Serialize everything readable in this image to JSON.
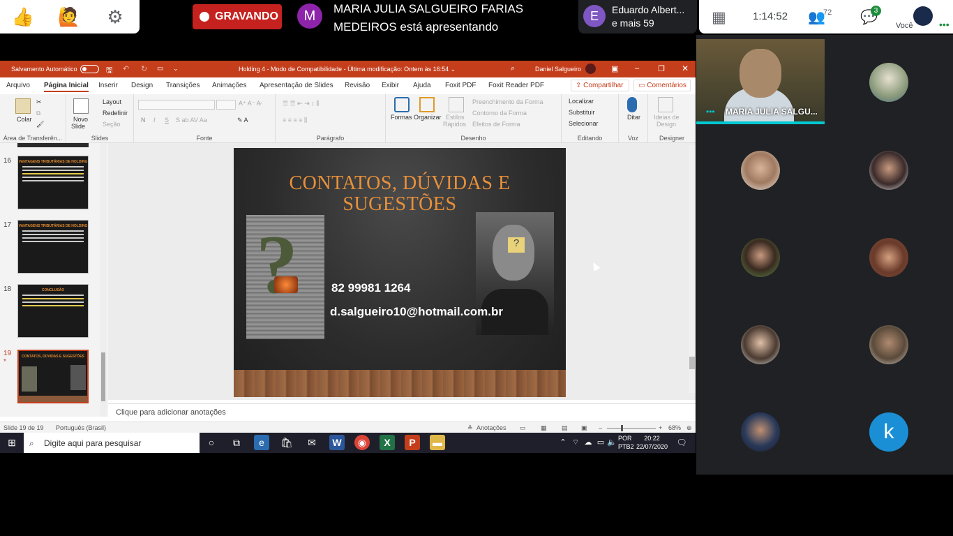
{
  "meet": {
    "recording_label": "GRAVANDO",
    "presenter_initial": "M",
    "presenter_line1": "MARIA JULIA SALGUEIRO FARIAS",
    "presenter_line2": "MEDEIROS está apresentando",
    "others_initial": "E",
    "others_line1": "Eduardo Albert...",
    "others_line2": "e mais 59",
    "timer": "1:14:52",
    "people_count": "72",
    "chat_badge": "3",
    "self_label": "Você",
    "speaker_name": "MARIA JULIA SALGU...",
    "participant_k": "k"
  },
  "ppt": {
    "autosave_label": "Salvamento Automático",
    "doc_title": "Holding 4  -  Modo de Compatibilidade  -  Última modificação: Ontem às 16:54  ⌄",
    "user_name": "Daniel Salgueiro",
    "menu": [
      "Arquivo",
      "Página Inicial",
      "Inserir",
      "Design",
      "Transições",
      "Animações",
      "Apresentação de Slides",
      "Revisão",
      "Exibir",
      "Ajuda",
      "Foxit PDF",
      "Foxit Reader PDF"
    ],
    "share_label": "Compartilhar",
    "comments_label": "Comentários",
    "ribbon": {
      "colar": "Colar",
      "area_transferencia": "Área de Transferên...",
      "novo_slide": "Novo",
      "novo_slide2": "Slide",
      "layout": "Layout",
      "redefinir": "Redefinir",
      "secao": "Seção",
      "slides": "Slides",
      "fonte": "Fonte",
      "paragrafo": "Parágrafo",
      "formas": "Formas",
      "organizar": "Organizar",
      "estilos": "Estilos",
      "estilos2": "Rápidos",
      "preenchimento": "Preenchimento da Forma",
      "contorno": "Contorno da Forma",
      "efeitos": "Efeitos de Forma",
      "desenho": "Desenho",
      "localizar": "Localizar",
      "substituir": "Substituir",
      "selecionar": "Selecionar",
      "editando": "Editando",
      "ditar": "Ditar",
      "voz": "Voz",
      "ideias": "Ideias de",
      "ideias2": "Design",
      "designer": "Designer"
    },
    "thumbnails": [
      {
        "num": "16",
        "title": "VANTAGENS TRIBUTÁRIAS DE HOLDING"
      },
      {
        "num": "17",
        "title": "VANTAGENS TRIBUTÁRIAS DE HOLDING"
      },
      {
        "num": "18",
        "title": "CONCLUSÃO"
      },
      {
        "num": "19",
        "title": "CONTATOS, DÚVIDAS E SUGESTÕES"
      }
    ],
    "slide": {
      "title_line1": "CONTATOS, DÚVIDAS E",
      "title_line2": "SUGESTÕES",
      "phone": "82 99981 1264",
      "email": "d.salgueiro10@hotmail.com.br"
    },
    "notes_placeholder": "Clique para adicionar anotações",
    "status": {
      "slide_count": "Slide 19 de 19",
      "language": "Português (Brasil)",
      "notes": "Anotações",
      "zoom": "68%"
    }
  },
  "taskbar": {
    "search_placeholder": "Digite aqui para pesquisar",
    "lang1": "POR",
    "lang2": "PTB2",
    "time": "20:22",
    "date": "22/07/2020"
  }
}
